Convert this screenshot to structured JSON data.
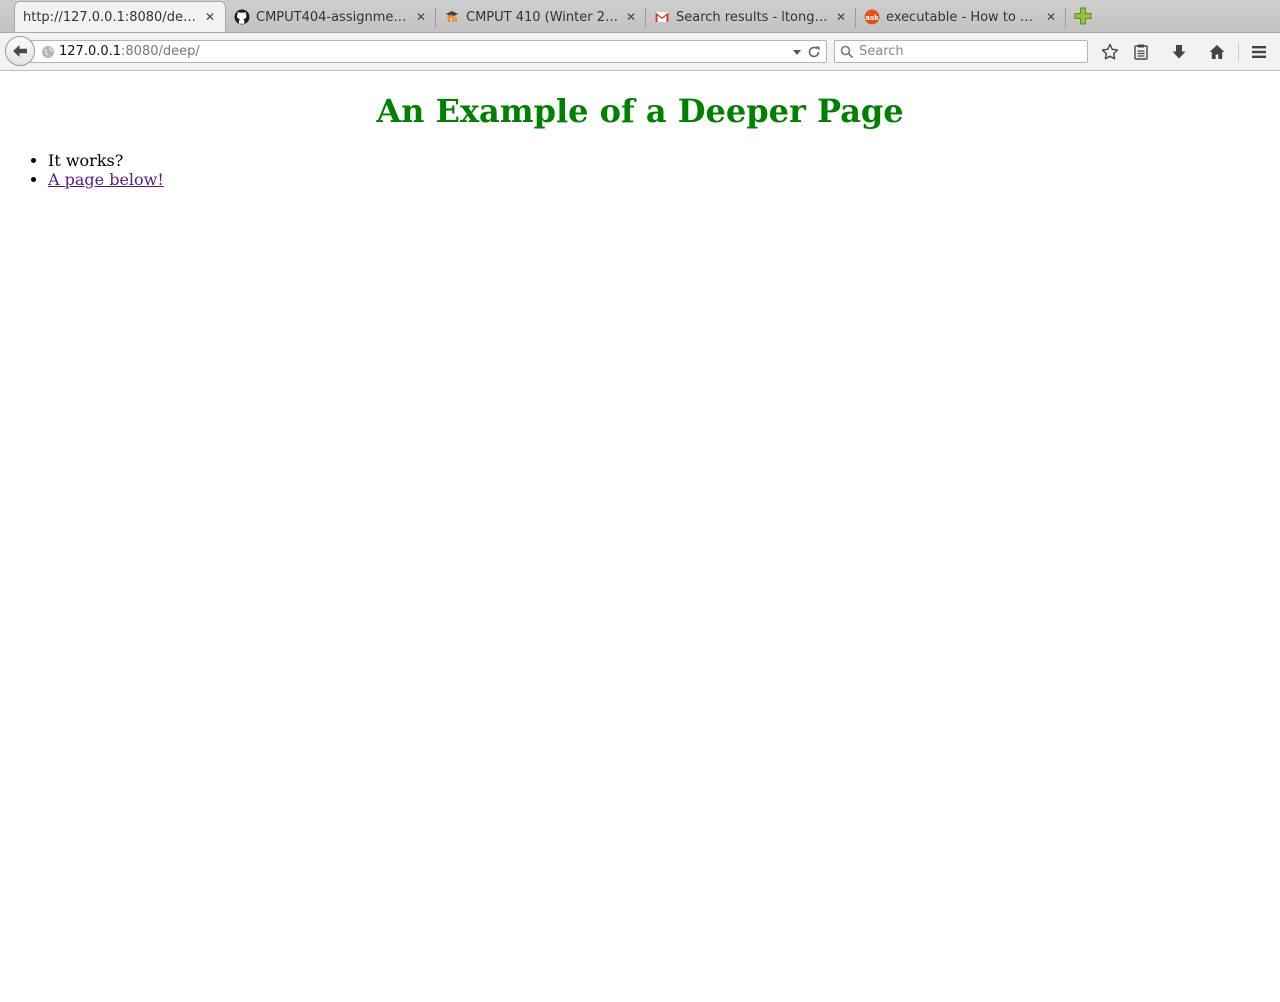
{
  "browser": {
    "tabs": [
      {
        "title": "http://127.0.0.1:8080/deep/",
        "icon": "none",
        "active": true
      },
      {
        "title": "CMPUT404-assignme…",
        "icon": "github-icon",
        "active": false
      },
      {
        "title": "CMPUT 410 (Winter 2…",
        "icon": "moodle-icon",
        "active": false
      },
      {
        "title": "Search results - ltong…",
        "icon": "gmail-icon",
        "active": false
      },
      {
        "title": "executable - How to …",
        "icon": "askubuntu-icon",
        "active": false
      }
    ],
    "url": {
      "host": "127.0.0.1",
      "path": ":8080/deep/"
    },
    "search": {
      "placeholder": "Search"
    }
  },
  "page": {
    "heading": "An Example of a Deeper Page",
    "heading_color": "#008000",
    "list": [
      {
        "text": "It works?",
        "link": false
      },
      {
        "text": "A page below!",
        "link": true
      }
    ],
    "link_color": "#551a8b"
  }
}
